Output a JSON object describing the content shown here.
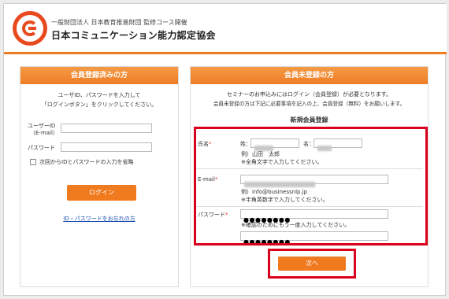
{
  "header": {
    "org_line": "一般財団法人 日本教育推進財団 監修コース開催",
    "org_name": "日本コミュニケーション能力認定協会"
  },
  "login_panel": {
    "title": "会員登録済みの方",
    "intro_line1": "ユーザID、パスワードを入力して",
    "intro_line2": "「ログインボタン」をクリックしてください。",
    "user_id_label1": "ユーザーID",
    "user_id_label2": "（E-mail）",
    "password_label": "パスワード",
    "remember_label": "次回からIDとパスワードの入力を省略",
    "login_button": "ログイン",
    "forgot_link": "ID・パスワードをお忘れの方"
  },
  "register_panel": {
    "title": "会員未登録の方",
    "intro_line1": "セミナーのお申込みにはログイン（会員登録）が必要となります。",
    "intro_line2": "会員未登録の方は下記に必要事項を記入の上、会員登録（無料）をお願いします。",
    "form_title": "新規会員登録",
    "name_label": "氏名",
    "required_mark": "*",
    "last_name_label": "姓：",
    "first_name_label": "名：",
    "name_example": "例）山田　太郎",
    "name_note": "※全角文字で入力してください。",
    "email_label": "E-mail",
    "email_example": "例）info@businessnlp.jp",
    "email_note": "※半角英数字で入力してください。",
    "password_label": "パスワード",
    "password_value": "●●●●●●●●",
    "password_confirm_note": "※確認のためにもう一度入力してください。",
    "password_confirm_value": "●●●●●●●●",
    "next_button": "次へ"
  },
  "colors": {
    "accent": "#f07a1e",
    "highlight": "#d9001b",
    "link": "#1a4fb0"
  }
}
